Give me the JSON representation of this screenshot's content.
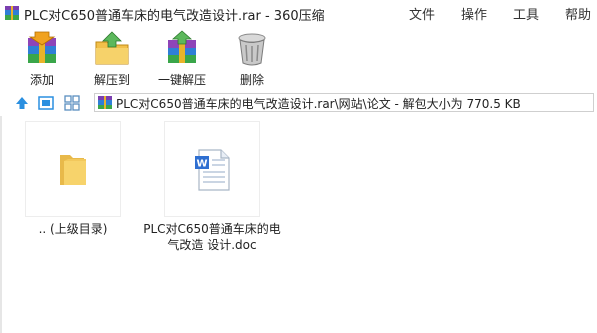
{
  "window": {
    "title": "PLC对C650普通车床的电气改造设计.rar - 360压缩"
  },
  "menu": [
    "文件",
    "操作",
    "工具",
    "帮助"
  ],
  "toolbar": [
    {
      "label": "添加",
      "icon": "add-archive-icon"
    },
    {
      "label": "解压到",
      "icon": "extract-to-icon"
    },
    {
      "label": "一键解压",
      "icon": "one-click-extract-icon"
    },
    {
      "label": "删除",
      "icon": "delete-trash-icon"
    }
  ],
  "address": {
    "path": "PLC对C650普通车床的电气改造设计.rar\\网站\\论文 - 解包大小为 770.5 KB"
  },
  "files": [
    {
      "name": ".. (上级目录)",
      "icon": "folder-icon"
    },
    {
      "name_line1": "PLC对C650普通车床的电",
      "name_line2": "气改造 设计.doc",
      "icon": "word-doc-icon"
    }
  ]
}
